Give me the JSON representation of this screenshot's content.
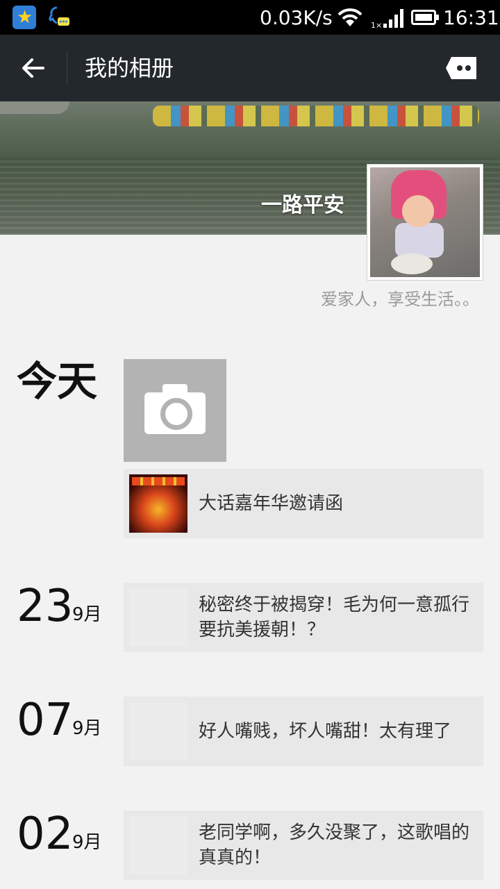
{
  "status_bar": {
    "net_speed": "0.03K/s",
    "time": "16:31",
    "icons": [
      "app-notification-icon",
      "qq-chat-icon",
      "wifi-icon",
      "signal-icon",
      "battery-icon"
    ]
  },
  "header": {
    "title": "我的相册",
    "back_icon": "arrow-left-icon",
    "more_icon": "comment-more-icon"
  },
  "profile": {
    "nickname": "一路平安",
    "signature": "爱家人，享受生活。。"
  },
  "timeline": [
    {
      "day": "今天",
      "month": "",
      "has_camera": true,
      "post": {
        "text": "大话嘉年华邀请函",
        "thumb": "fire"
      }
    },
    {
      "day": "23",
      "month": "9月",
      "has_camera": false,
      "post": {
        "text": "秘密终于被揭穿！毛为何一意孤行要抗美援朝！？",
        "thumb": "blank"
      }
    },
    {
      "day": "07",
      "month": "9月",
      "has_camera": false,
      "post": {
        "text": "好人嘴贱，坏人嘴甜！太有理了",
        "thumb": "blank"
      }
    },
    {
      "day": "02",
      "month": "9月",
      "has_camera": false,
      "post": {
        "text": "老同学啊，多久没聚了，这歌唱的真真的！",
        "thumb": "blank"
      }
    }
  ],
  "colors": {
    "titlebar": "#23282d",
    "background": "#f2f2f2",
    "card": "#e8e8e8",
    "camera_placeholder": "#b3b3b3"
  }
}
